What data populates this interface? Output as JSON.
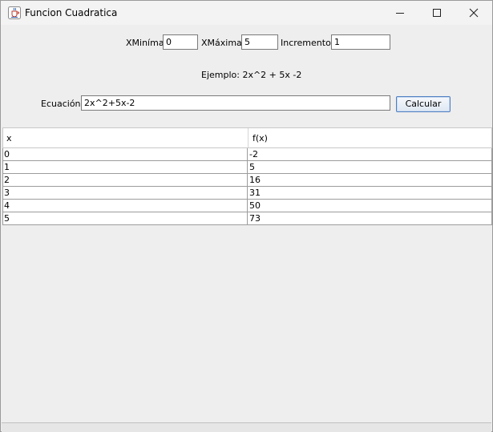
{
  "window": {
    "title": "Funcion Cuadratica",
    "controls": [
      "minimize-icon",
      "maximize-icon",
      "close-icon"
    ]
  },
  "form": {
    "xmin_label": "XMiníma:",
    "xmin_value": "0",
    "xmax_label": "XMáxima:",
    "xmax_value": "5",
    "increment_label": "Incremento:",
    "increment_value": "1",
    "example_text": "Ejemplo: 2x^2 + 5x -2",
    "equation_label": "Ecuación:",
    "equation_value": "2x^2+5x-2",
    "calculate_label": "Calcular"
  },
  "table": {
    "headers": [
      "x",
      "f(x)"
    ],
    "rows": [
      [
        "0",
        "-2"
      ],
      [
        "1",
        "5"
      ],
      [
        "2",
        "16"
      ],
      [
        "3",
        "31"
      ],
      [
        "4",
        "50"
      ],
      [
        "5",
        "73"
      ]
    ]
  }
}
